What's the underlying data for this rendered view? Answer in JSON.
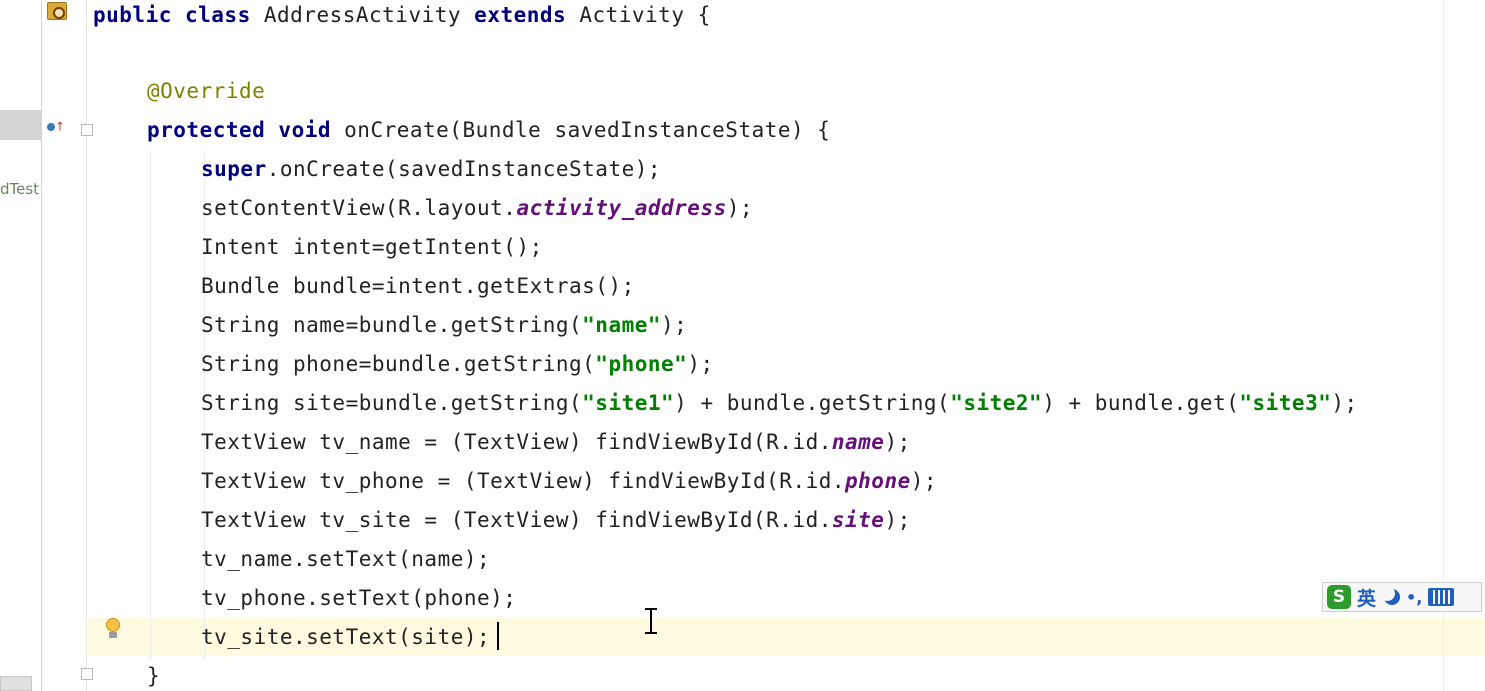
{
  "project_panel": {
    "truncated_label": "dTest"
  },
  "editor": {
    "lines": [
      {
        "tokens": [
          {
            "t": "public class ",
            "c": "kw"
          },
          {
            "t": "AddressActivity ",
            "c": ""
          },
          {
            "t": "extends ",
            "c": "kw"
          },
          {
            "t": "Activity {",
            "c": ""
          }
        ]
      },
      {
        "tokens": [
          {
            "t": "@Override",
            "c": "ann"
          }
        ]
      },
      {
        "tokens": [
          {
            "t": "protected void ",
            "c": "kw"
          },
          {
            "t": "onCreate(Bundle savedInstanceState) {",
            "c": ""
          }
        ]
      },
      {
        "tokens": [
          {
            "t": "super",
            "c": "kw"
          },
          {
            "t": ".onCreate(savedInstanceState);",
            "c": ""
          }
        ]
      },
      {
        "tokens": [
          {
            "t": "setContentView(R.layout.",
            "c": ""
          },
          {
            "t": "activity_address",
            "c": "fld"
          },
          {
            "t": ");",
            "c": ""
          }
        ]
      },
      {
        "tokens": [
          {
            "t": "Intent intent=getIntent();",
            "c": ""
          }
        ]
      },
      {
        "tokens": [
          {
            "t": "Bundle bundle=intent.getExtras();",
            "c": ""
          }
        ]
      },
      {
        "tokens": [
          {
            "t": "String name=bundle.getString(",
            "c": ""
          },
          {
            "t": "\"name\"",
            "c": "str"
          },
          {
            "t": ");",
            "c": ""
          }
        ]
      },
      {
        "tokens": [
          {
            "t": "String phone=bundle.getString(",
            "c": ""
          },
          {
            "t": "\"phone\"",
            "c": "str"
          },
          {
            "t": ");",
            "c": ""
          }
        ]
      },
      {
        "tokens": [
          {
            "t": "String site=bundle.getString(",
            "c": ""
          },
          {
            "t": "\"site1\"",
            "c": "str"
          },
          {
            "t": ") + bundle.getString(",
            "c": ""
          },
          {
            "t": "\"site2\"",
            "c": "str"
          },
          {
            "t": ") + bundle.get(",
            "c": ""
          },
          {
            "t": "\"site3\"",
            "c": "str"
          },
          {
            "t": ");",
            "c": ""
          }
        ]
      },
      {
        "tokens": [
          {
            "t": "TextView tv_name = (TextView) findViewById(R.id.",
            "c": ""
          },
          {
            "t": "name",
            "c": "fld"
          },
          {
            "t": ");",
            "c": ""
          }
        ]
      },
      {
        "tokens": [
          {
            "t": "TextView tv_phone = (TextView) findViewById(R.id.",
            "c": ""
          },
          {
            "t": "phone",
            "c": "fld"
          },
          {
            "t": ");",
            "c": ""
          }
        ]
      },
      {
        "tokens": [
          {
            "t": "TextView tv_site = (TextView) findViewById(R.id.",
            "c": ""
          },
          {
            "t": "site",
            "c": "fld"
          },
          {
            "t": ");",
            "c": ""
          }
        ]
      },
      {
        "tokens": [
          {
            "t": "tv_name.setText(name);",
            "c": ""
          }
        ]
      },
      {
        "tokens": [
          {
            "t": "tv_phone.setText(phone);",
            "c": ""
          }
        ]
      },
      {
        "tokens": [
          {
            "t": "tv_site.setText(site);",
            "c": ""
          }
        ]
      },
      {
        "tokens": [
          {
            "t": "}",
            "c": ""
          }
        ]
      }
    ]
  },
  "ime_toolbar": {
    "logo": "S",
    "language": "英",
    "punct": "•,",
    "icons": [
      "sogou-logo-icon",
      "moon-icon",
      "punctuation-icon",
      "keyboard-icon"
    ]
  },
  "colors": {
    "keyword": "#000080",
    "annotation": "#808000",
    "field": "#660e7a",
    "string": "#008000",
    "current_line": "#fffbe0"
  }
}
